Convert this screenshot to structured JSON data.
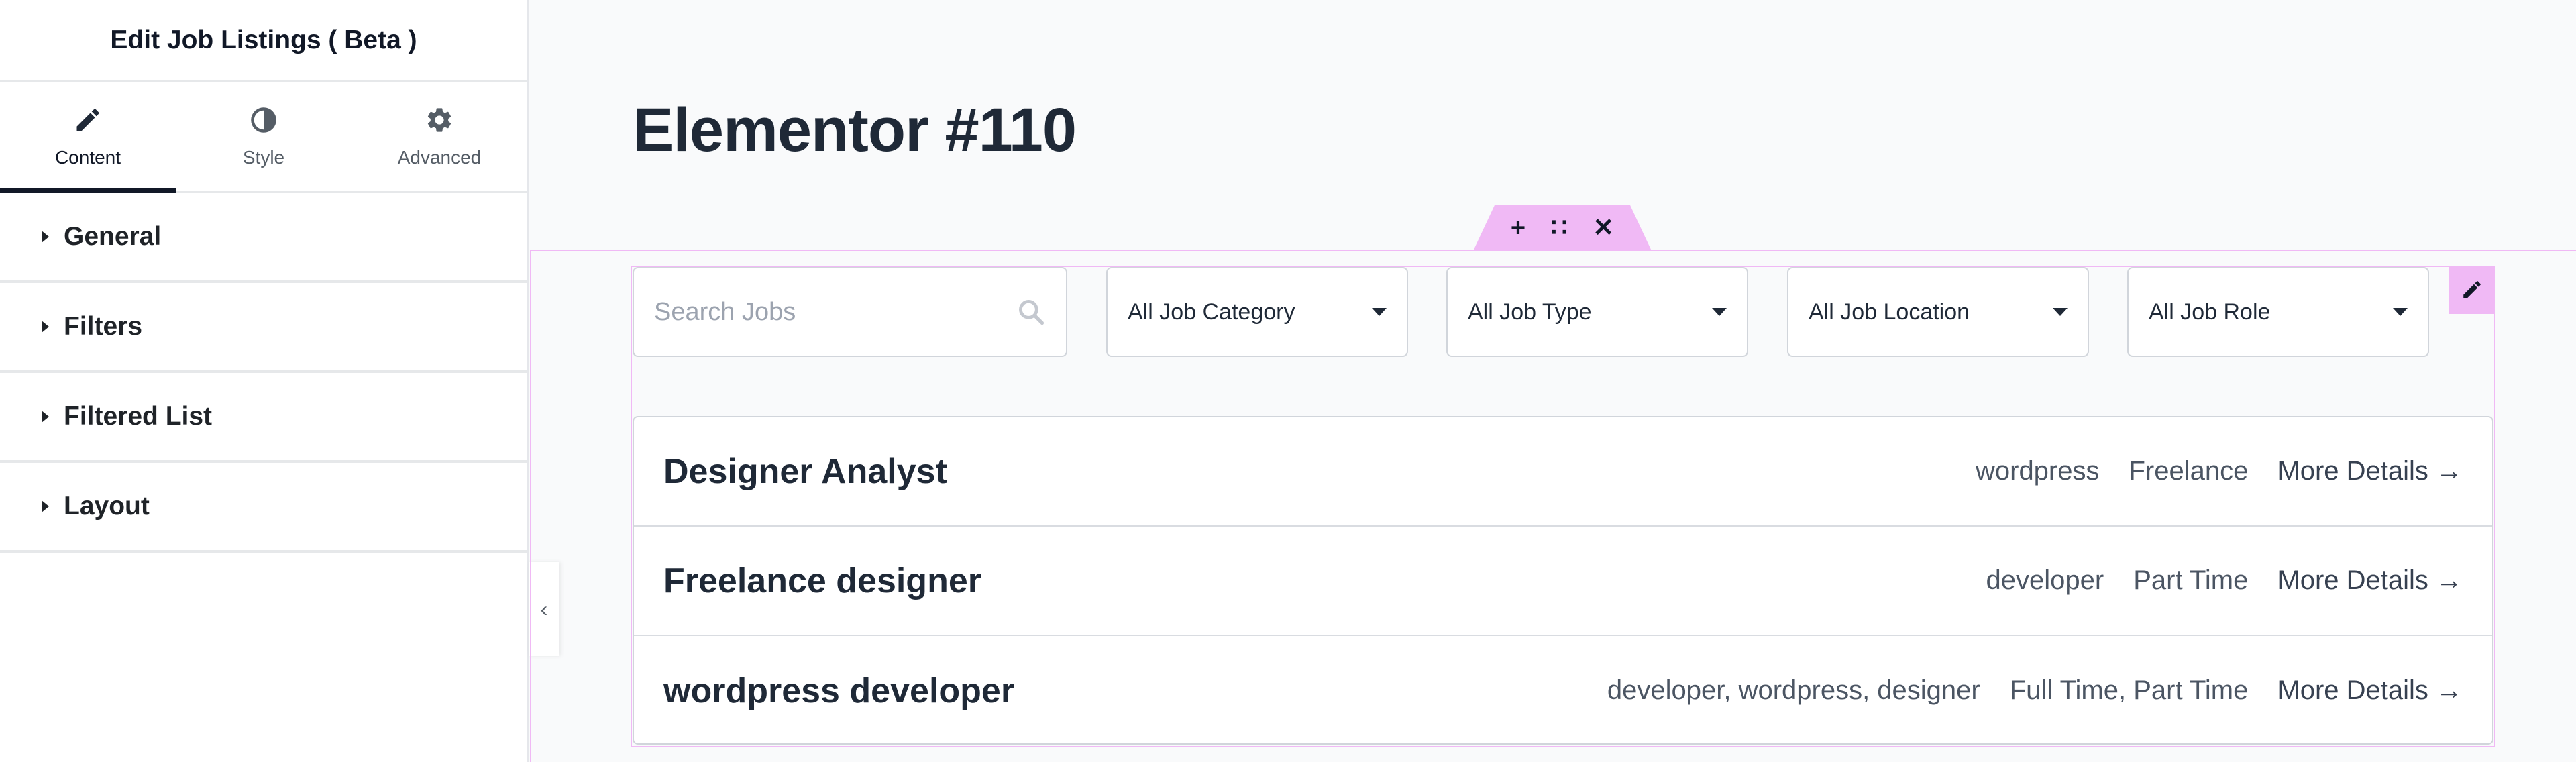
{
  "panel": {
    "title": "Edit Job Listings ( Beta )",
    "tabs": [
      {
        "label": "Content",
        "icon": "pencil-icon",
        "active": true
      },
      {
        "label": "Style",
        "icon": "half-circle-icon",
        "active": false
      },
      {
        "label": "Advanced",
        "icon": "gear-icon",
        "active": false
      }
    ],
    "sections": [
      {
        "label": "General"
      },
      {
        "label": "Filters"
      },
      {
        "label": "Filtered List"
      },
      {
        "label": "Layout"
      }
    ]
  },
  "page": {
    "title": "Elementor #110"
  },
  "section_handle": {
    "add": "+",
    "drag": "∷",
    "close": "✕"
  },
  "filters": {
    "search_placeholder": "Search Jobs",
    "category": "All Job Category",
    "type": "All Job Type",
    "location": "All Job Location",
    "role": "All Job Role"
  },
  "jobs": [
    {
      "title": "Designer Analyst",
      "categories": "wordpress",
      "type": "Freelance",
      "more": "More Details →"
    },
    {
      "title": "Freelance designer",
      "categories": "developer",
      "type": "Part Time",
      "more": "More Details →"
    },
    {
      "title": "wordpress developer",
      "categories": "developer, wordpress, designer",
      "type": "Full Time, Part Time",
      "more": "More Details →"
    }
  ],
  "colors": {
    "accent_outline": "#f0b9f5",
    "text_dark": "#1f2937",
    "panel_bg": "#ffffff",
    "canvas_bg": "#f9fafb"
  }
}
